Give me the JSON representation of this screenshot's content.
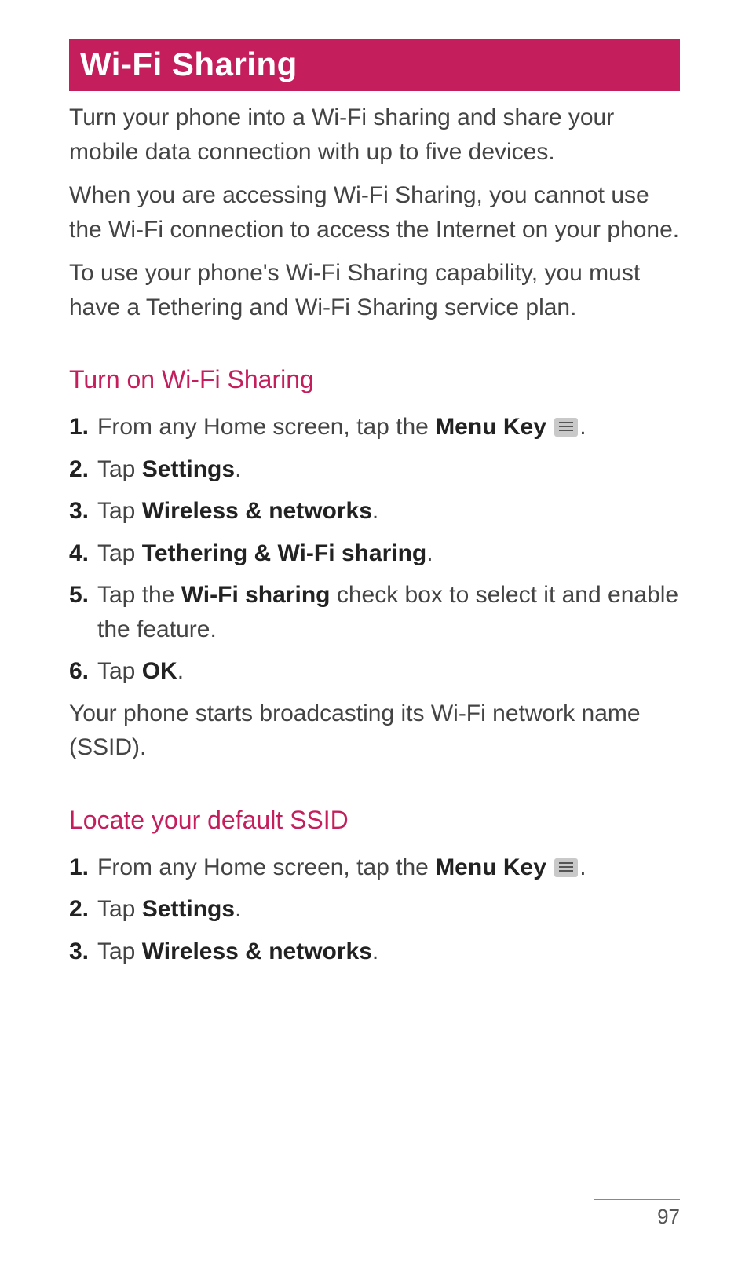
{
  "title": "Wi-Fi Sharing",
  "intro": {
    "p1": "Turn your phone into a Wi-Fi sharing and share your mobile data connection with up to five devices.",
    "p2": "When you are accessing Wi-Fi Sharing, you cannot use the Wi-Fi connection to access the Internet on your phone.",
    "p3": "To use your phone's Wi-Fi Sharing capability, you must have a Tethering and Wi-Fi Sharing service plan."
  },
  "section1": {
    "heading": "Turn on Wi-Fi Sharing",
    "steps": {
      "s1a": "From any Home screen, tap the ",
      "s1b": "Menu Key",
      "s1c": " ",
      "s1d": ".",
      "s2a": "Tap ",
      "s2b": "Settings",
      "s2c": ".",
      "s3a": "Tap ",
      "s3b": "Wireless & networks",
      "s3c": ".",
      "s4a": "Tap ",
      "s4b": "Tethering & Wi-Fi sharing",
      "s4c": ".",
      "s5a": "Tap the ",
      "s5b": "Wi-Fi sharing",
      "s5c": " check box to select it and enable the feature.",
      "s6a": "Tap ",
      "s6b": "OK",
      "s6c": "."
    },
    "after": "Your phone starts broadcasting its Wi-Fi network name (SSID)."
  },
  "section2": {
    "heading": "Locate your default SSID",
    "steps": {
      "s1a": "From any Home screen, tap the ",
      "s1b": "Menu Key",
      "s1c": " ",
      "s1d": ".",
      "s2a": "Tap ",
      "s2b": "Settings",
      "s2c": ".",
      "s3a": "Tap ",
      "s3b": "Wireless & networks",
      "s3c": "."
    }
  },
  "pageNumber": "97"
}
